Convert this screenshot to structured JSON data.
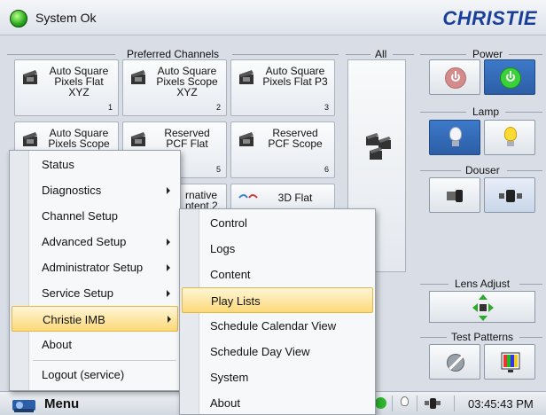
{
  "status": {
    "text": "System Ok",
    "led_color": "#26a61a"
  },
  "brand": {
    "name": "CHRISTIE",
    "color": "#1a3f9a"
  },
  "sections": {
    "preferred_channels": "Preferred Channels",
    "all": "All",
    "power": "Power",
    "lamp": "Lamp",
    "douser": "Douser",
    "lens_adjust": "Lens Adjust",
    "test_patterns": "Test Patterns"
  },
  "channels": [
    {
      "label": "Auto Square Pixels Flat XYZ",
      "number": "1",
      "icon": "clapperboard-icon"
    },
    {
      "label": "Auto Square Pixels Scope XYZ",
      "number": "2",
      "icon": "clapperboard-icon"
    },
    {
      "label": "Auto Square Pixels Flat P3",
      "number": "3",
      "icon": "clapperboard-icon"
    },
    {
      "label": "Auto Square Pixels Scope",
      "number": "",
      "icon": "clapperboard-icon"
    },
    {
      "label": "Reserved PCF Flat",
      "number": "5",
      "icon": "clapperboard-icon"
    },
    {
      "label": "Reserved PCF Scope",
      "number": "6",
      "icon": "clapperboard-icon"
    },
    {
      "label": "rnative ntent 2",
      "number": "",
      "icon": ""
    },
    {
      "label": "3D Flat",
      "number": "",
      "icon": "3d-glasses-icon"
    }
  ],
  "taskbar": {
    "menu_label": "Menu",
    "clock": "03:45:43 PM"
  },
  "main_menu": {
    "items": [
      {
        "label": "Status",
        "submenu": false
      },
      {
        "label": "Diagnostics",
        "submenu": true
      },
      {
        "label": "Channel Setup",
        "submenu": false
      },
      {
        "label": "Advanced Setup",
        "submenu": true
      },
      {
        "label": "Administrator Setup",
        "submenu": true
      },
      {
        "label": "Service Setup",
        "submenu": true
      },
      {
        "label": "Christie IMB",
        "submenu": true,
        "highlighted": true
      },
      {
        "label": "About",
        "submenu": false
      },
      {
        "label": "Logout (service)",
        "submenu": false
      }
    ]
  },
  "imb_submenu": {
    "items": [
      {
        "label": "Control"
      },
      {
        "label": "Logs"
      },
      {
        "label": "Content"
      },
      {
        "label": "Play Lists",
        "highlighted": true
      },
      {
        "label": "Schedule Calendar View"
      },
      {
        "label": "Schedule Day View"
      },
      {
        "label": "System"
      },
      {
        "label": "About"
      }
    ]
  }
}
